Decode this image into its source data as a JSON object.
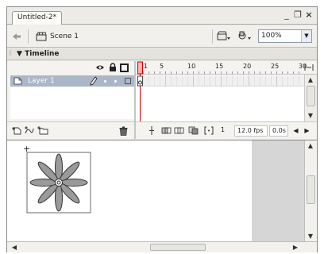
{
  "window": {
    "doc_tab_label": "Untitled-2*",
    "minimize_glyph": "_",
    "restore_glyph": "❐",
    "close_glyph": "×"
  },
  "edit_bar": {
    "scene_label": "Scene 1",
    "zoom_value": "100%"
  },
  "timeline": {
    "title": "Timeline",
    "frame_numbers": [
      "1",
      "5",
      "10",
      "15",
      "20",
      "25",
      "30"
    ],
    "layers": [
      {
        "name": "Layer 1"
      }
    ],
    "status": {
      "current_frame": "1",
      "frame_rate": "12.0 fps",
      "elapsed_time": "0.0s"
    }
  },
  "icons": {
    "back": "back-arrow-icon",
    "scene": "scene-icon",
    "edit_scene": "edit-scene-icon",
    "edit_symbol": "edit-symbol-icon",
    "eye": "eye-icon",
    "lock": "lock-icon",
    "outline": "outline-icon",
    "pencil": "pencil-icon",
    "trash": "trash-icon"
  },
  "colors": {
    "layer_selected": "#aab7c9",
    "playhead": "#cc0000",
    "petal_fill": "#9a9a9a",
    "stage_bg": "#ffffff",
    "pasteboard": "#d6d6d6"
  }
}
